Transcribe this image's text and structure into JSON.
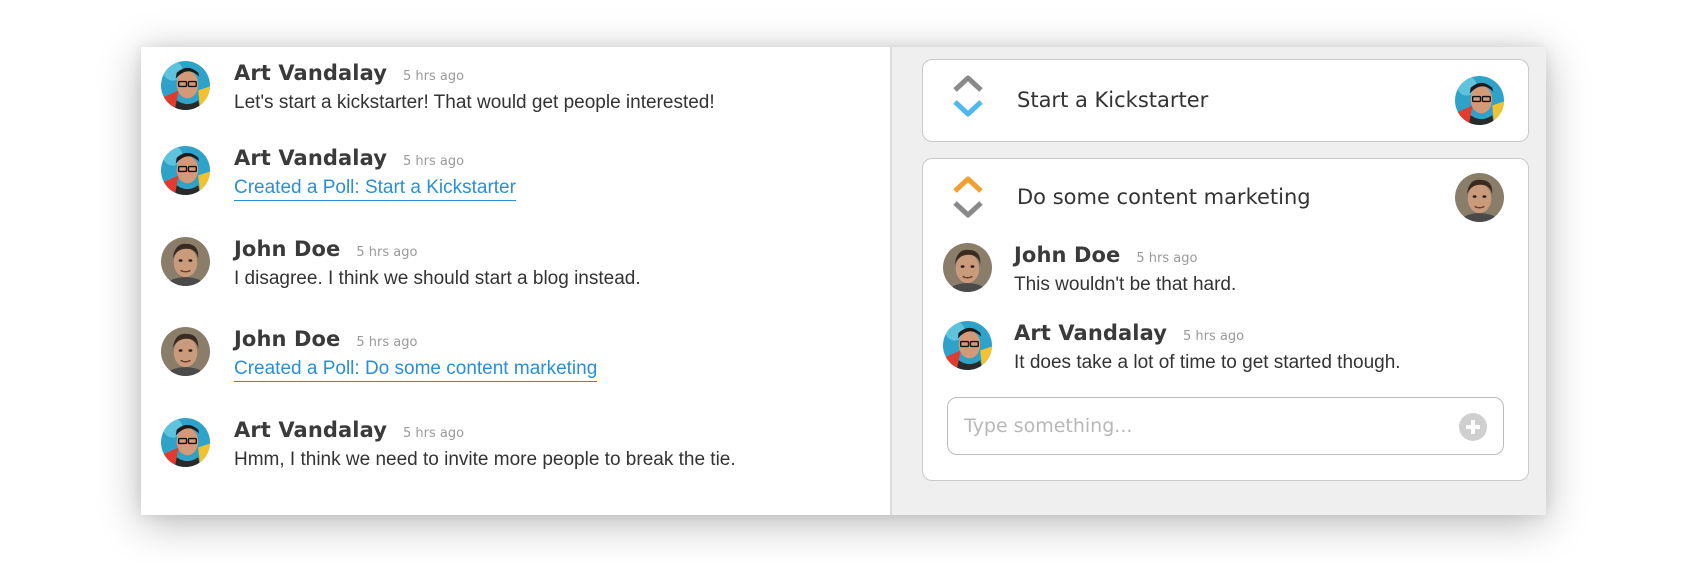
{
  "feed": {
    "messages": [
      {
        "author": "Art Vandalay",
        "time": "5 hrs ago",
        "text": "Let's start a kickstarter! That would get people interested!",
        "avatar": "art-avatar",
        "is_link": false
      },
      {
        "author": "Art Vandalay",
        "time": "5 hrs ago",
        "text": "Created a Poll: Start a Kickstarter",
        "avatar": "art-avatar",
        "is_link": true
      },
      {
        "author": "John Doe",
        "time": "5 hrs ago",
        "text": "I disagree. I think we should start a blog instead.",
        "avatar": "john-avatar",
        "is_link": false
      },
      {
        "author": "John Doe",
        "time": "5 hrs ago",
        "text": "Created a Poll: Do some content marketing",
        "avatar": "john-avatar",
        "is_link": true
      },
      {
        "author": "Art Vandalay",
        "time": "5 hrs ago",
        "text": "Hmm, I think we need to invite more people to break the tie.",
        "avatar": "art-avatar",
        "is_link": false
      }
    ]
  },
  "polls": [
    {
      "title": "Start a Kickstarter",
      "vote_state": "downvoted",
      "avatar": "art-avatar"
    },
    {
      "title": "Do some content marketing",
      "vote_state": "upvoted",
      "avatar": "john-avatar",
      "comments": [
        {
          "author": "John Doe",
          "time": "5 hrs ago",
          "text": "This wouldn't be that hard.",
          "avatar": "john-avatar"
        },
        {
          "author": "Art Vandalay",
          "time": "5 hrs ago",
          "text": "It does take a lot of time to get started though.",
          "avatar": "art-avatar"
        }
      ],
      "input": {
        "placeholder": "Type something...",
        "value": ""
      }
    }
  ],
  "colors": {
    "link": "#2a8fd6",
    "upvote_active": "#f0a030",
    "downvote_active": "#4fb8ef",
    "vote_inactive": "#8a8a8a",
    "panel_bg": "#efefef"
  }
}
